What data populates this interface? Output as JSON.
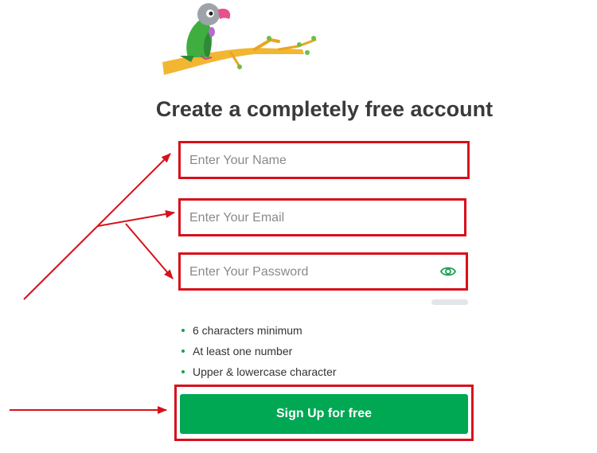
{
  "signup": {
    "title": "Create a completely free account",
    "name_placeholder": "Enter Your Name",
    "email_placeholder": "Enter Your Email",
    "password_placeholder": "Enter Your Password",
    "password_rules": [
      "6 characters minimum",
      "At least one number",
      "Upper & lowercase character"
    ],
    "submit_label": "Sign Up for free"
  },
  "icons": {
    "logo": "parrot-on-branch",
    "password_toggle": "eye-icon"
  },
  "colors": {
    "brand_green": "#00a854",
    "annotation_red": "#d8101b",
    "title_text": "#3a3a3a"
  }
}
